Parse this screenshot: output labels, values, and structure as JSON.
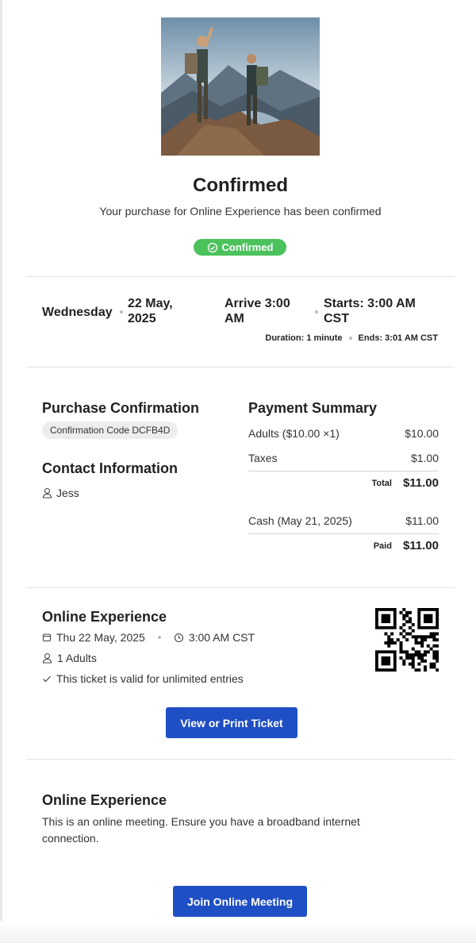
{
  "header": {
    "title": "Confirmed",
    "subtitle": "Your purchase for Online Experience has been confirmed",
    "status_badge": "Confirmed"
  },
  "schedule": {
    "day": "Wednesday",
    "date_line1": "22 May,",
    "date_line2": "2025",
    "arrive_line1": "Arrive 3:00",
    "arrive_line2": "AM",
    "starts_line1": "Starts: 3:00 AM",
    "starts_line2": "CST",
    "duration": "Duration: 1 minute",
    "ends": "Ends: 3:01 AM CST"
  },
  "purchase": {
    "heading": "Purchase Confirmation",
    "code": "Confirmation Code DCFB4D"
  },
  "contact": {
    "heading": "Contact Information",
    "name": "Jess"
  },
  "payment": {
    "heading": "Payment Summary",
    "items": [
      {
        "label": "Adults ($10.00 ×1)",
        "amount": "$10.00"
      },
      {
        "label": "Taxes",
        "amount": "$1.00"
      }
    ],
    "total_label": "Total",
    "total_value": "$11.00",
    "payments": [
      {
        "label": "Cash (May 21, 2025)",
        "amount": "$11.00"
      }
    ],
    "paid_label": "Paid",
    "paid_value": "$11.00"
  },
  "ticket": {
    "heading": "Online Experience",
    "date": "Thu 22 May, 2025",
    "time": "3:00 AM CST",
    "attendees": "1 Adults",
    "validity": "This ticket is valid for unlimited entries",
    "button": "View or Print Ticket"
  },
  "online": {
    "heading": "Online Experience",
    "description_line1": "This is an online meeting. Ensure you have a broadband internet",
    "description_line2": "connection.",
    "button": "Join Online Meeting"
  },
  "colors": {
    "accent": "#1f4fc4",
    "success": "#4cc25d"
  },
  "icons": [
    "check-circle-icon",
    "user-icon",
    "calendar-icon",
    "clock-icon",
    "checkmark-icon",
    "qr-code-icon"
  ]
}
